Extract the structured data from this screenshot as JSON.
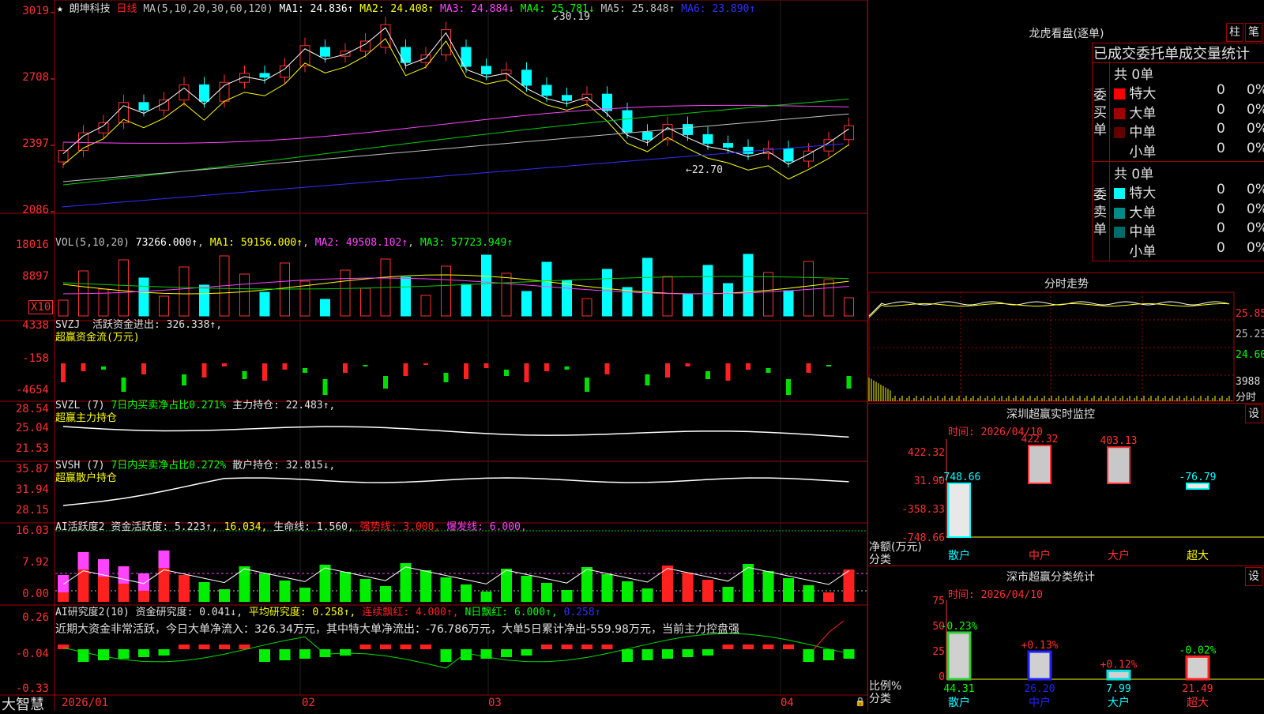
{
  "main": {
    "star": "★",
    "stock_name": "朗坤科技",
    "period": "日线",
    "ma_params": "MA(5,10,20,30,60,120)",
    "ma": [
      {
        "label": "MA1: 24.836↑",
        "color": "#ffffff"
      },
      {
        "label": "MA2: 24.408↑",
        "color": "#ffff00"
      },
      {
        "label": "MA3: 24.884↓",
        "color": "#ff44ff"
      },
      {
        "label": "MA4: 25.781↓",
        "color": "#00ff00"
      },
      {
        "label": "MA5: 25.848↑",
        "color": "#c0c0c0"
      },
      {
        "label": "MA6: 23.890↑",
        "color": "#3030ff"
      }
    ],
    "high_label": "30.19",
    "low_label": "←22.70",
    "y_ticks": [
      "3019",
      "2708",
      "2397",
      "2086"
    ]
  },
  "vol": {
    "title": "VOL(5,10,20)",
    "value": "73266.000↑",
    "ma1": "MA1: 59156.000↑",
    "ma2": "MA2: 49508.102↑",
    "ma3": "MA3: 57723.949↑",
    "y_ticks": [
      "18016",
      "8897"
    ],
    "unit": "X10"
  },
  "svzj": {
    "title": "SVZJ",
    "label": "活跃资金进出: 326.338↑,",
    "subtitle": "超赢资金流(万元)",
    "y_ticks": [
      "4338",
      "-158",
      "-4654"
    ]
  },
  "svzl": {
    "title": "SVZL (7)",
    "ratio": "7日内买卖净占比0.271%",
    "holding": "主力持仓: 22.483↑,",
    "subtitle": "超赢主力持仓",
    "y_ticks": [
      "28.54",
      "25.04",
      "21.53"
    ]
  },
  "svsh": {
    "title": "SVSH (7)",
    "ratio": "7日内买卖净占比0.272%",
    "holding": "散户持仓: 32.815↓,",
    "subtitle": "超赢散户持仓",
    "y_ticks": [
      "35.87",
      "31.94",
      "28.15"
    ]
  },
  "ai_active": {
    "title": "AI活跃度2",
    "fund": "资金活跃度: 5.223↑,",
    "v2": "16.034,",
    "life": "生命线: 1.560,",
    "strong": "强势线: 3.000,",
    "burst": "爆发线: 6.000,",
    "y_ticks": [
      "16.03",
      "7.92",
      "0.00"
    ]
  },
  "ai_research": {
    "title": "AI研究度2(10)",
    "fund": "资金研究度: 0.041↓,",
    "avg": "平均研究度: 0.258↑,",
    "cont": "连续飘红: 4.000↑,",
    "nday": "N日飘红: 6.000↑,",
    "last": "0.258↑",
    "summary": "近期大资金非常活跃，今日大单净流入：326.34万元，其中特大单净流出：-76.786万元，大单5日累计净出-559.98万元，当前主力控盘强",
    "y_ticks": [
      "0.26",
      "-0.04",
      "-0.33"
    ]
  },
  "date_axis": [
    "2026/01",
    "02",
    "03",
    "04"
  ],
  "logo": "大智慧",
  "right": {
    "dragon": {
      "title": "龙虎看盘(逐单)",
      "btn1": "柱",
      "btn2": "笔",
      "header": "已成交委托单成交量统计",
      "buy_label": "委买单",
      "sell_label": "委卖单",
      "buy_total": "共 0单",
      "sell_total": "共 0单",
      "buy_rows": [
        {
          "name": "特大",
          "val": "0",
          "pct": "0%",
          "color": "#ff0000"
        },
        {
          "name": "大单",
          "val": "0",
          "pct": "0%",
          "color": "#a00000"
        },
        {
          "name": "中单",
          "val": "0",
          "pct": "0%",
          "color": "#600000"
        },
        {
          "name": "小单",
          "val": "0",
          "pct": "0%",
          "color": "#000000"
        }
      ],
      "sell_rows": [
        {
          "name": "特大",
          "val": "0",
          "pct": "0%",
          "color": "#00ffff"
        },
        {
          "name": "大单",
          "val": "0",
          "pct": "0%",
          "color": "#008b8b"
        },
        {
          "name": "中单",
          "val": "0",
          "pct": "0%",
          "color": "#006b6b"
        },
        {
          "name": "小单",
          "val": "0",
          "pct": "0%",
          "color": "#000000"
        }
      ]
    },
    "intraday": {
      "title": "分时走势",
      "prices": [
        "25.85",
        "25.23",
        "24.60"
      ],
      "vol_value": "3988",
      "vol_label": "分时"
    },
    "monitor": {
      "title": "深圳超赢实时监控",
      "set_btn": "设",
      "time": "时间: 2026/04/10",
      "y_ticks": [
        "422.32",
        "31.90",
        "-358.33",
        "-748.66"
      ],
      "axis_name1": "净额(万元)",
      "axis_name2": "分类",
      "bars": [
        {
          "cat": "散户",
          "value": -748.66,
          "label": "-748.66"
        },
        {
          "cat": "中户",
          "value": 422.32,
          "label": "422.32"
        },
        {
          "cat": "大户",
          "value": 403.13,
          "label": "403.13"
        },
        {
          "cat": "超大",
          "value": -76.79,
          "label": "-76.79"
        }
      ]
    },
    "classify": {
      "title": "深市超赢分类统计",
      "set_btn": "设",
      "time": "时间: 2026/04/10",
      "y_ticks": [
        "75",
        "50",
        "25",
        "0"
      ],
      "axis_name1": "比例%",
      "axis_name2": "分类",
      "bars": [
        {
          "cat": "散户",
          "value": 44.31,
          "top": "-0.23%",
          "bottom": "44.31",
          "color": "#2ecc2e"
        },
        {
          "cat": "中户",
          "value": 26.2,
          "top": "+0.13%",
          "bottom": "26.20",
          "color": "#2020ff"
        },
        {
          "cat": "大户",
          "value": 7.99,
          "top": "+0.12%",
          "bottom": "7.99",
          "color": "#00e0e0"
        },
        {
          "cat": "超大",
          "value": 21.49,
          "top": "-0.02%",
          "bottom": "21.49",
          "color": "#ff2020"
        }
      ]
    }
  },
  "chart_data": {
    "type": "bar",
    "title": "深圳超赢实时监控",
    "categories": [
      "散户",
      "中户",
      "大户",
      "超大"
    ],
    "series": [
      {
        "name": "净额(万元)",
        "values": [
          -748.66,
          422.32,
          403.13,
          -76.79
        ]
      },
      {
        "name": "比例%",
        "values": [
          44.31,
          26.2,
          7.99,
          21.49
        ]
      }
    ]
  }
}
